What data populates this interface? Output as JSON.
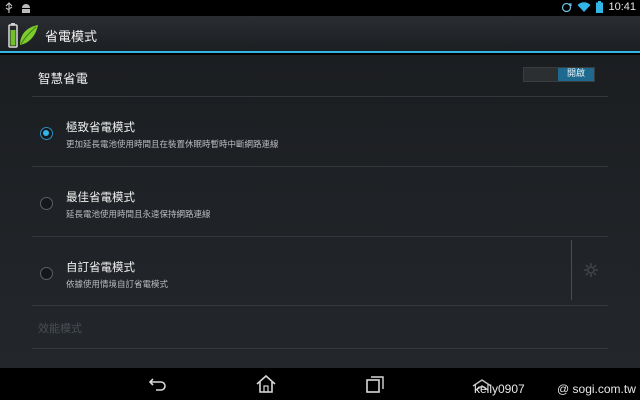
{
  "status_bar": {
    "time": "10:41",
    "icons": [
      "usb-icon",
      "android-icon",
      "sync-icon",
      "wifi-icon",
      "battery-icon"
    ]
  },
  "action_bar": {
    "title": "省電模式",
    "icon": "battery-leaf-icon",
    "accent": "#33b5e5"
  },
  "smart_saving": {
    "label": "智慧省電",
    "toggle_label": "開啟",
    "enabled": true
  },
  "options": [
    {
      "title": "極致省電模式",
      "subtitle": "更加延長電池使用時間且在裝置休眠時暫時中斷網路連線",
      "selected": true
    },
    {
      "title": "最佳省電模式",
      "subtitle": "延長電池使用時間且永遠保持網路連線",
      "selected": false
    },
    {
      "title": "自訂省電模式",
      "subtitle": "依據使用情境自訂省電模式",
      "selected": false
    }
  ],
  "section_performance": "效能模式",
  "nav_bar": {
    "buttons": [
      "back-icon",
      "home-icon",
      "recent-apps-icon",
      "screenshot-icon"
    ]
  },
  "watermark": {
    "user": "kelly0907",
    "site": "@ sogi.com.tw"
  }
}
